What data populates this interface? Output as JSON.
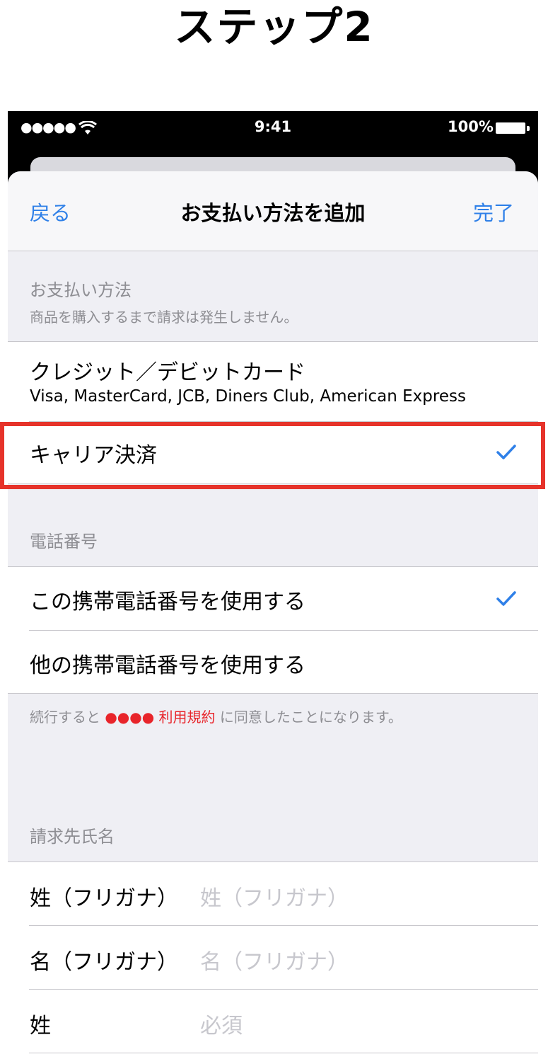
{
  "page": {
    "step_title": "ステップ2"
  },
  "statusbar": {
    "signal": "●●●●●",
    "time": "9:41",
    "battery": "100%"
  },
  "nav": {
    "back": "戻る",
    "title": "お支払い方法を追加",
    "done": "完了"
  },
  "payment_section": {
    "header": "お支払い方法",
    "subheader": "商品を購入するまで請求は発生しません。",
    "options": [
      {
        "title": "クレジット／デビットカード",
        "subtitle": "Visa, MasterCard, JCB, Diners Club, American Express",
        "selected": false
      },
      {
        "title": "キャリア決済",
        "selected": true
      }
    ]
  },
  "phone_section": {
    "header": "電話番号",
    "options": [
      {
        "title": "この携帯電話番号を使用する",
        "selected": true
      },
      {
        "title": "他の携帯電話番号を使用する",
        "selected": false
      }
    ],
    "footer_prefix": "続行すると",
    "footer_dots": "●●●●",
    "footer_link": "利用規約",
    "footer_suffix": "に同意したことになります。"
  },
  "billing_section": {
    "header": "請求先氏名",
    "fields": [
      {
        "label": "姓（フリガナ）",
        "placeholder": "姓（フリガナ）"
      },
      {
        "label": "名（フリガナ）",
        "placeholder": "名（フリガナ）"
      },
      {
        "label": "姓",
        "placeholder": "必須"
      }
    ]
  },
  "colors": {
    "accent": "#2f80e8",
    "highlight": "#e6332a",
    "link": "#e8242a"
  }
}
